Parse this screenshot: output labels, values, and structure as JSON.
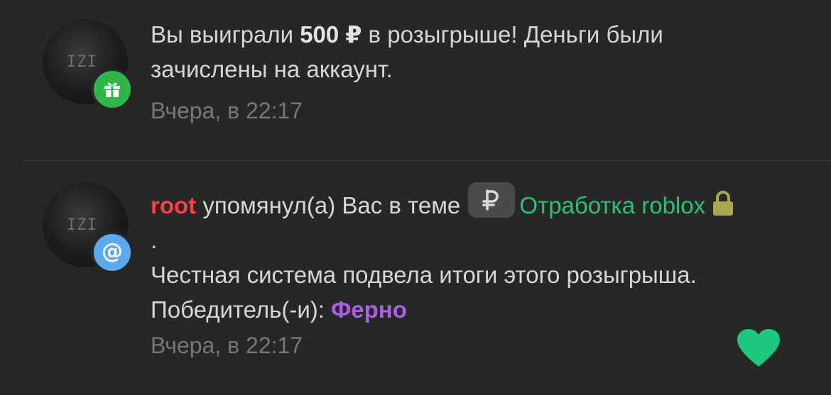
{
  "notifications": [
    {
      "type": "giveaway-win",
      "badge_icon": "gift-icon",
      "badge_color": "#2fb54a",
      "avatar_text": "IZI",
      "text_prefix": "Вы выиграли ",
      "amount": "500 ₽",
      "text_suffix": " в розыгрыше! Деньги были зачислены на аккаунт.",
      "time": "Вчера, в 22:17"
    },
    {
      "type": "mention",
      "badge_icon": "at-icon",
      "badge_symbol": "@",
      "badge_color": "#5ba9f0",
      "avatar_text": "IZI",
      "username": "root",
      "username_color": "#f2434b",
      "action_text": " упомянул(а) Вас в теме ",
      "thread_prefix_icon": "ruble-icon",
      "thread_title": "Отработка roblox",
      "thread_color": "#28c17a",
      "thread_lock_icon": "lock-icon",
      "after_thread": ".",
      "message": "Честная система подвела итоги этого розыгрыша. Победитель(-и): ",
      "winner": "Ферно",
      "winner_color": "#ab5fe6",
      "time": "Вчера, в 22:17",
      "like_icon": "heart-icon",
      "like_color": "#1cc77f"
    }
  ]
}
